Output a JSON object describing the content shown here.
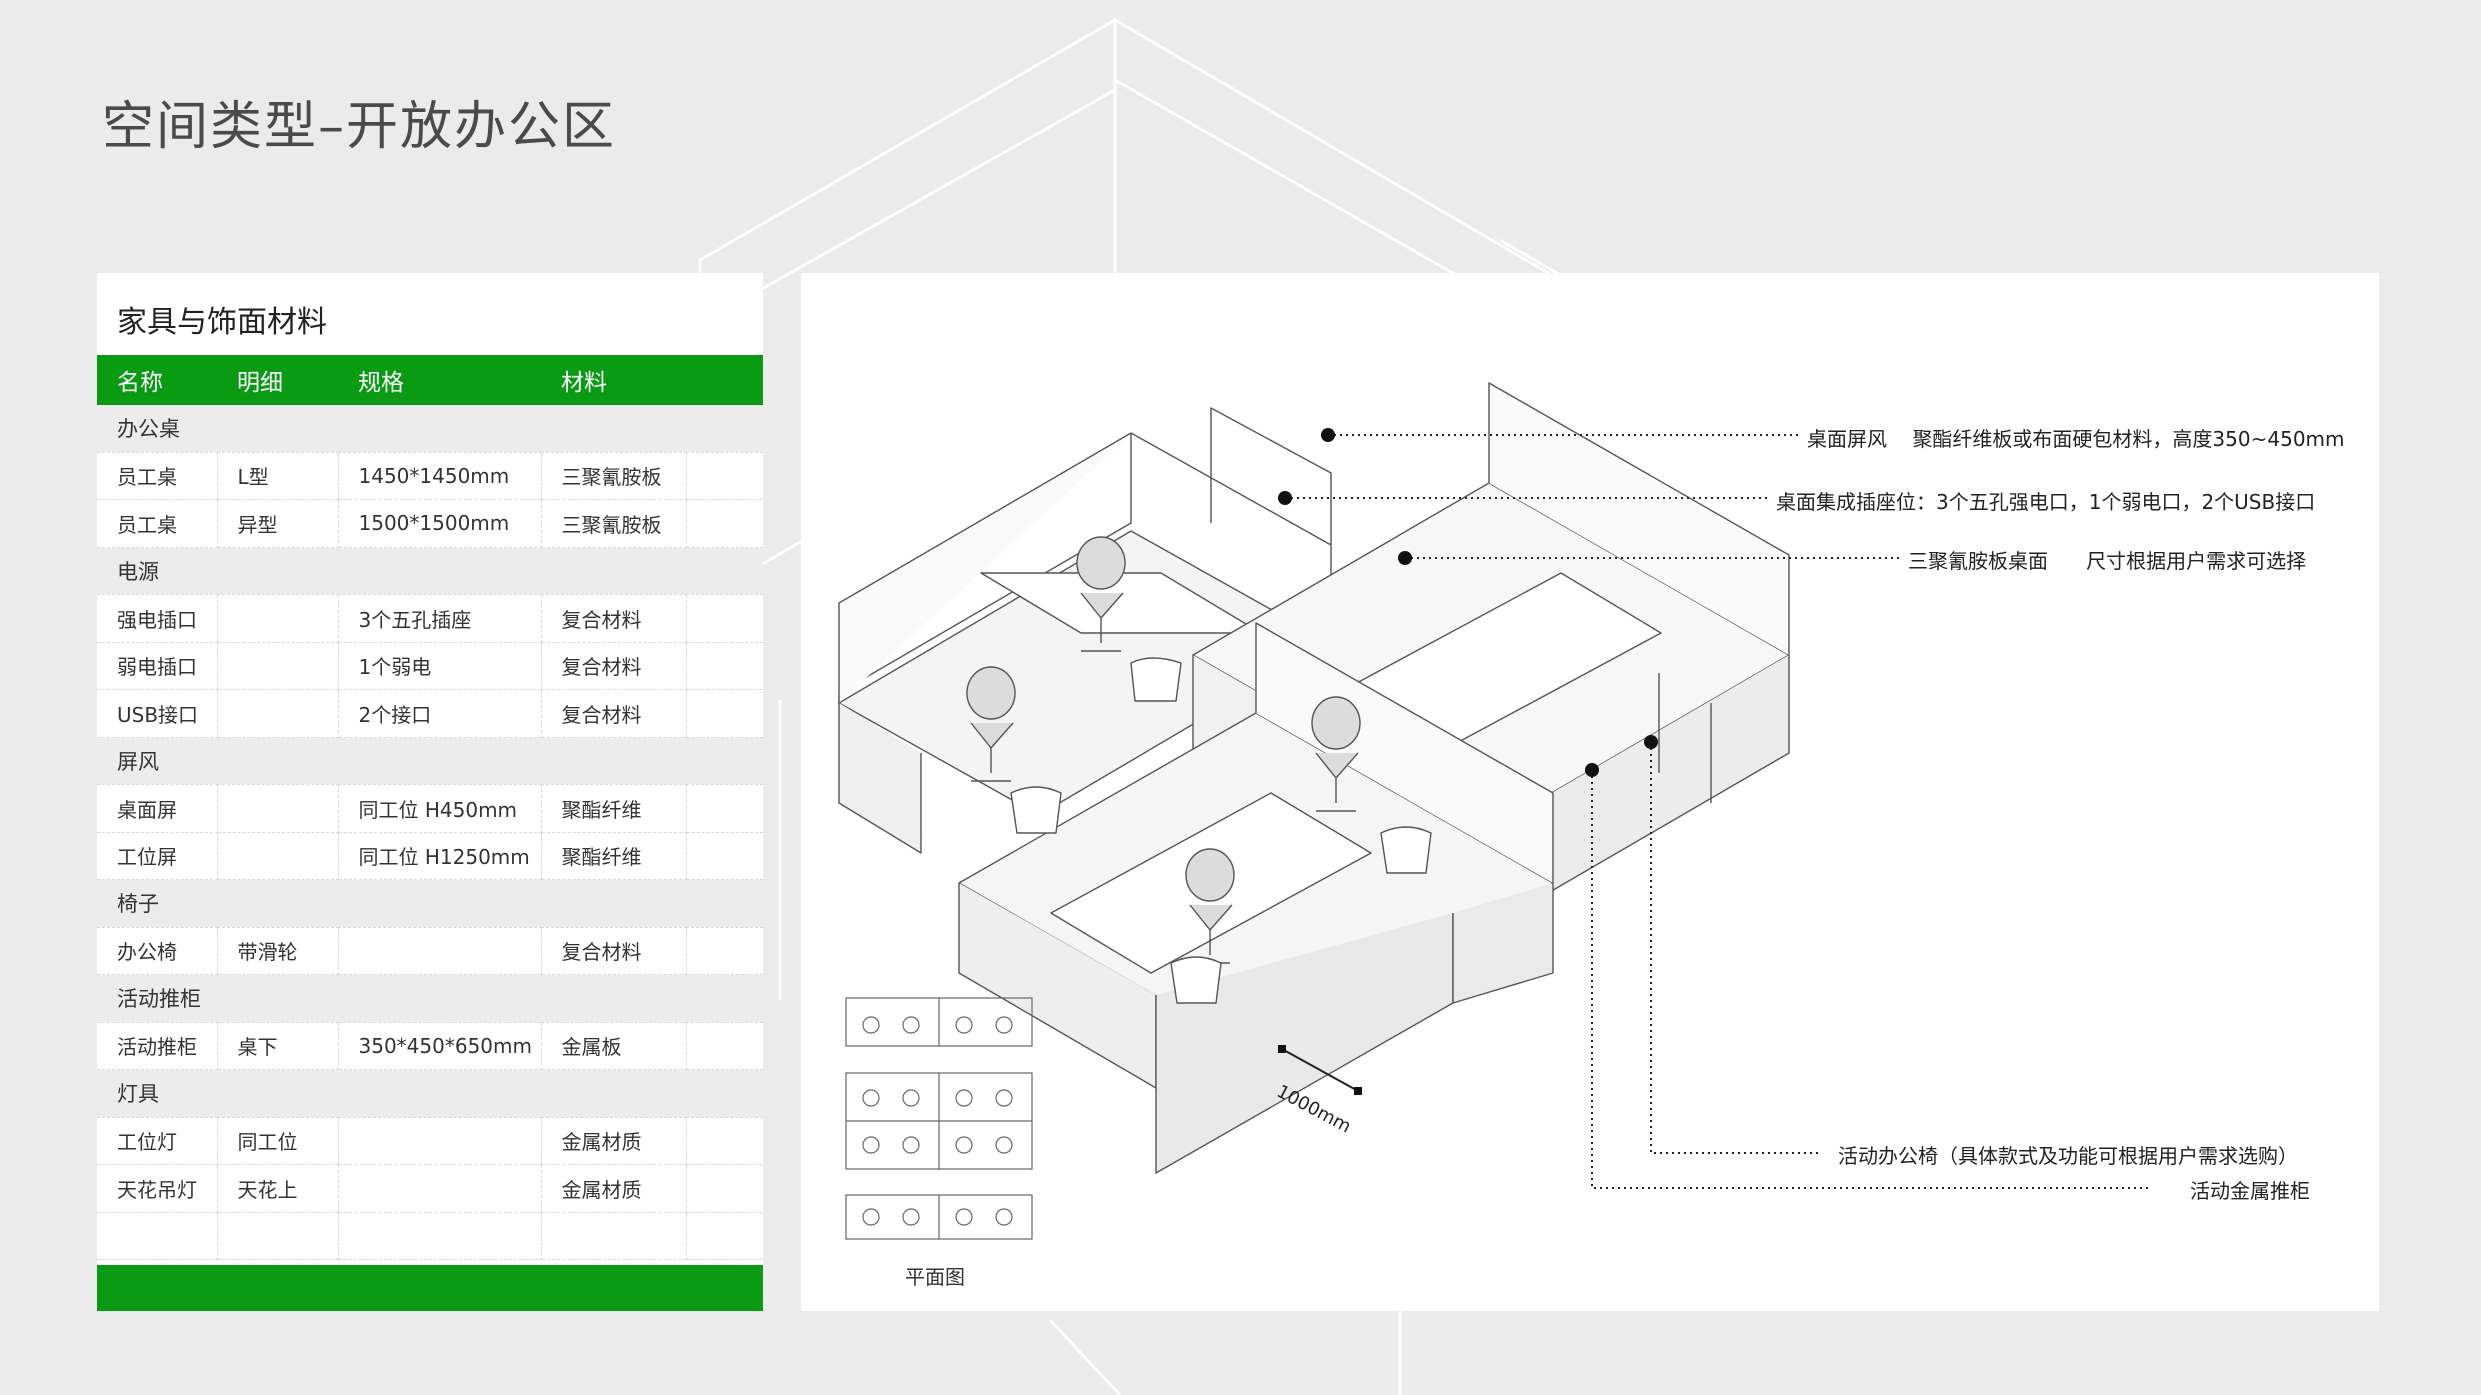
{
  "page": {
    "title": "空间类型–开放办公区"
  },
  "materials": {
    "title": "家具与饰面材料",
    "headers": [
      "名称",
      "明细",
      "规格",
      "材料"
    ],
    "rows": [
      {
        "type": "section",
        "name": "办公桌"
      },
      {
        "type": "item",
        "name": "员工桌",
        "detail": "L型",
        "spec": "1450*1450mm",
        "material": "三聚氰胺板"
      },
      {
        "type": "item",
        "name": "员工桌",
        "detail": "异型",
        "spec": "1500*1500mm",
        "material": "三聚氰胺板"
      },
      {
        "type": "section",
        "name": "电源"
      },
      {
        "type": "item",
        "name": "强电插口",
        "detail": "",
        "spec": "3个五孔插座",
        "material": "复合材料"
      },
      {
        "type": "item",
        "name": "弱电插口",
        "detail": "",
        "spec": "1个弱电",
        "material": "复合材料"
      },
      {
        "type": "item",
        "name": "USB接口",
        "detail": "",
        "spec": "2个接口",
        "material": "复合材料"
      },
      {
        "type": "section",
        "name": "屏风"
      },
      {
        "type": "item",
        "name": "桌面屏",
        "detail": "",
        "spec": "同工位 H450mm",
        "material": "聚酯纤维"
      },
      {
        "type": "item",
        "name": "工位屏",
        "detail": "",
        "spec": "同工位 H1250mm",
        "material": "聚酯纤维"
      },
      {
        "type": "section",
        "name": "椅子"
      },
      {
        "type": "item",
        "name": "办公椅",
        "detail": "带滑轮",
        "spec": "",
        "material": "复合材料"
      },
      {
        "type": "section",
        "name": "活动推柜"
      },
      {
        "type": "item",
        "name": "活动推柜",
        "detail": "桌下",
        "spec": "350*450*650mm",
        "material": "金属板"
      },
      {
        "type": "section",
        "name": "灯具"
      },
      {
        "type": "item",
        "name": "工位灯",
        "detail": "同工位",
        "spec": "",
        "material": "金属材质"
      },
      {
        "type": "item",
        "name": "天花吊灯",
        "detail": "天花上",
        "spec": "",
        "material": "金属材质"
      },
      {
        "type": "item",
        "name": "",
        "detail": "",
        "spec": "",
        "material": ""
      }
    ]
  },
  "diagram": {
    "callouts": [
      {
        "id": "screen",
        "label": "桌面屏风",
        "text": "聚酯纤维板或布面硬包材料，高度350~450mm"
      },
      {
        "id": "socket",
        "label": "桌面集成插座位：3个五孔强电口，1个弱电口，2个USB接口",
        "text": ""
      },
      {
        "id": "desk",
        "label": "三聚氰胺板桌面",
        "text": "尺寸根据用户需求可选择"
      },
      {
        "id": "chair",
        "label": "活动办公椅（具体款式及功能可根据用户需求选购）",
        "text": ""
      },
      {
        "id": "cabinet",
        "label": "活动金属推柜",
        "text": ""
      }
    ],
    "dimension": "1000mm",
    "plan_label": "平面图"
  },
  "colors": {
    "accent": "#0a9a14",
    "background": "#ebebeb",
    "panel": "#ffffff"
  }
}
